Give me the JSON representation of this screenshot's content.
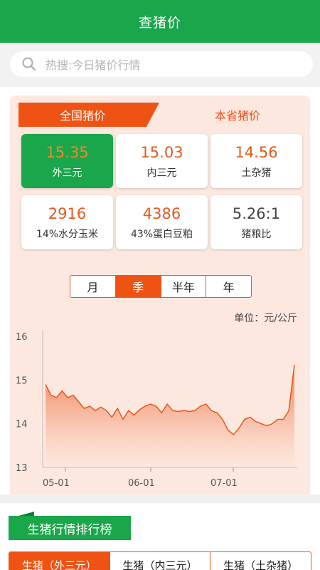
{
  "header": {
    "title": "查猪价"
  },
  "search": {
    "placeholder": "热搜:今日猪价行情"
  },
  "region_tabs": {
    "national": "全国猪价",
    "province": "本省猪价"
  },
  "prices": [
    {
      "value": "15.35",
      "label": "外三元"
    },
    {
      "value": "15.03",
      "label": "内三元"
    },
    {
      "value": "14.56",
      "label": "土杂猪"
    },
    {
      "value": "2916",
      "label": "14%水分玉米"
    },
    {
      "value": "4386",
      "label": "43%蛋白豆粕"
    },
    {
      "value": "5.26:1",
      "label": "猪粮比"
    }
  ],
  "period_tabs": [
    "月",
    "季",
    "半年",
    "年"
  ],
  "unit_label": "单位：元/公斤",
  "chart_data": {
    "type": "area",
    "ylim": [
      13,
      16
    ],
    "yticks": [
      "16",
      "15",
      "14",
      "13"
    ],
    "xticks": [
      "05-01",
      "06-01",
      "07-01"
    ],
    "y": [
      14.9,
      14.65,
      14.6,
      14.75,
      14.6,
      14.65,
      14.5,
      14.35,
      14.4,
      14.3,
      14.38,
      14.3,
      14.15,
      14.35,
      14.1,
      14.3,
      14.2,
      14.32,
      14.4,
      14.45,
      14.4,
      14.25,
      14.45,
      14.3,
      14.28,
      14.3,
      14.28,
      14.3,
      14.4,
      14.45,
      14.3,
      14.25,
      14.1,
      13.85,
      13.75,
      13.9,
      14.1,
      14.15,
      14.05,
      14.0,
      13.95,
      14.0,
      14.1,
      14.1,
      14.3,
      15.35
    ],
    "colors": {
      "line": "#e8561a",
      "fill_top": "#f0784a",
      "fill_bottom": "#fde8df"
    }
  },
  "ranking": {
    "title": "生猪行情排行榜",
    "tabs": [
      "生猪（外三元）",
      "生猪（内三元）",
      "生猪（土杂猪）"
    ]
  }
}
